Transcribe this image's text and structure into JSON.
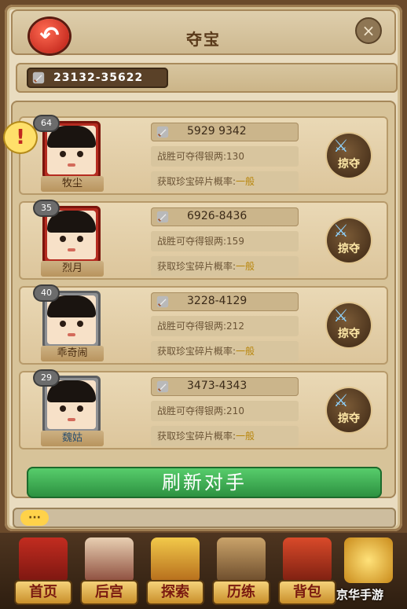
{
  "header": {
    "title": "夺宝",
    "back_icon": "back-arrow-icon",
    "close_icon": "close-icon"
  },
  "range": {
    "text": "23132-35622",
    "icon": "sword-icon"
  },
  "opponents": [
    {
      "level": "64",
      "name": "牧尘",
      "power": "5929 9342",
      "silver_label": "战胜可夺得银两:",
      "silver": "130",
      "chance_label": "获取珍宝碎片概率:",
      "chance": "一般",
      "frame": "red",
      "name_color": "brown",
      "plunder_label": "掠夺"
    },
    {
      "level": "35",
      "name": "烈月",
      "power": "6926-8436",
      "silver_label": "战胜可夺得银两:",
      "silver": "159",
      "chance_label": "获取珍宝碎片概率:",
      "chance": "一般",
      "frame": "red",
      "name_color": "brown",
      "plunder_label": "掠夺"
    },
    {
      "level": "40",
      "name": "乖奇闹",
      "power": "3228-4129",
      "silver_label": "战胜可夺得银两:",
      "silver": "212",
      "chance_label": "获取珍宝碎片概率:",
      "chance": "一般",
      "frame": "gray",
      "name_color": "brown",
      "plunder_label": "掠夺"
    },
    {
      "level": "29",
      "name": "魏姑",
      "power": "3473-4343",
      "silver_label": "战胜可夺得银两:",
      "silver": "210",
      "chance_label": "获取珍宝碎片概率:",
      "chance": "一般",
      "frame": "gray",
      "name_color": "blue",
      "plunder_label": "掠夺"
    }
  ],
  "refresh_label": "刷新对手",
  "chat_icon": "chat-bubble-icon",
  "nav": [
    {
      "label": "首页",
      "icon": "palace-icon"
    },
    {
      "label": "后宫",
      "icon": "consort-icon"
    },
    {
      "label": "探索",
      "icon": "explore-icon"
    },
    {
      "label": "历练",
      "icon": "training-icon"
    },
    {
      "label": "背包",
      "icon": "bag-icon"
    },
    {
      "label": "",
      "icon": "treasure-icon"
    }
  ],
  "watermark": "京华手游",
  "colors": {
    "accent_green": "#2a8e3e",
    "frame_red": "#b52b20",
    "frame_gray": "#8d8f92",
    "chance_gold": "#b8860b"
  }
}
